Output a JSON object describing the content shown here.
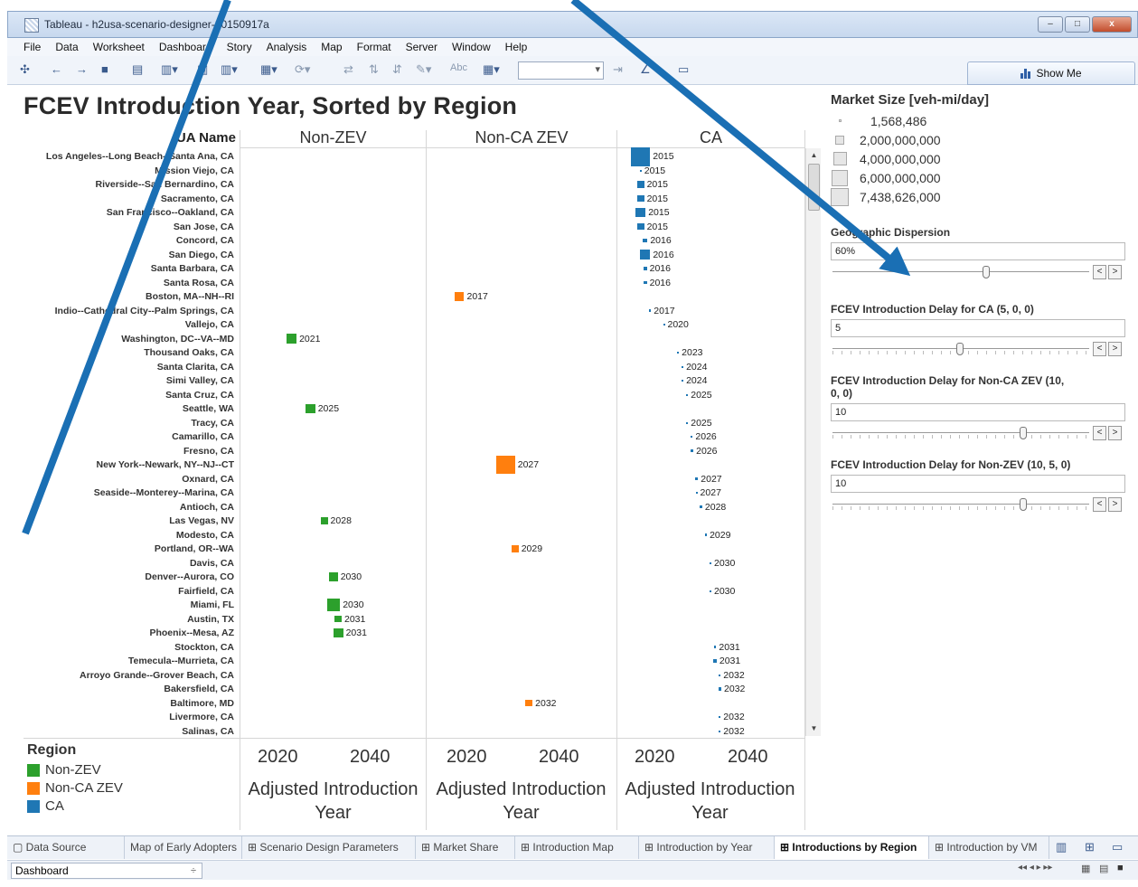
{
  "window": {
    "title": "Tableau - h2usa-scenario-designer-20150917a",
    "min": "–",
    "max": "□",
    "close": "x"
  },
  "menu": [
    "File",
    "Data",
    "Worksheet",
    "Dashboard",
    "Story",
    "Analysis",
    "Map",
    "Format",
    "Server",
    "Window",
    "Help"
  ],
  "toolbar": {
    "show_me": "Show Me",
    "abc": "Abc"
  },
  "viz": {
    "title": "FCEV Introduction Year, Sorted by Region",
    "row_header": "UA Name",
    "columns": [
      "Non-ZEV",
      "Non-CA ZEV",
      "CA"
    ],
    "x_ticks": [
      "2020",
      "2040"
    ],
    "x_title": "Adjusted Introduction Year"
  },
  "colors": {
    "Non-ZEV": "#2ca02c",
    "Non-CA ZEV": "#ff7f0e",
    "CA": "#1f77b4"
  },
  "chart_data": {
    "type": "scatter",
    "title": "FCEV Introduction Year, Sorted by Region",
    "xlabel": "Adjusted Introduction Year",
    "ylabel": "UA Name",
    "facets": [
      "Non-ZEV",
      "Non-CA ZEV",
      "CA"
    ],
    "xlim": [
      2010,
      2050
    ],
    "size_encoding": "Market Size [veh-mi/day]",
    "rows": [
      {
        "name": "Los Angeles--Long Beach--Santa Ana, CA",
        "region": "CA",
        "year": 2015,
        "size": 7438626000
      },
      {
        "name": "Mission Viejo, CA",
        "region": "CA",
        "year": 2015,
        "size": 1568486
      },
      {
        "name": "Riverside--San Bernardino, CA",
        "region": "CA",
        "year": 2015,
        "size": 1000000000
      },
      {
        "name": "Sacramento, CA",
        "region": "CA",
        "year": 2015,
        "size": 1000000000
      },
      {
        "name": "San Francisco--Oakland, CA",
        "region": "CA",
        "year": 2015,
        "size": 2000000000
      },
      {
        "name": "San Jose, CA",
        "region": "CA",
        "year": 2015,
        "size": 1000000000
      },
      {
        "name": "Concord, CA",
        "region": "CA",
        "year": 2016,
        "size": 400000000
      },
      {
        "name": "San Diego, CA",
        "region": "CA",
        "year": 2016,
        "size": 2000000000
      },
      {
        "name": "Santa Barbara, CA",
        "region": "CA",
        "year": 2016,
        "size": 200000000
      },
      {
        "name": "Santa Rosa, CA",
        "region": "CA",
        "year": 2016,
        "size": 200000000
      },
      {
        "name": "Boston, MA--NH--RI",
        "region": "Non-CA ZEV",
        "year": 2017,
        "size": 2000000000
      },
      {
        "name": "Indio--Cathedral City--Palm Springs, CA",
        "region": "CA",
        "year": 2017,
        "size": 100000000
      },
      {
        "name": "Vallejo, CA",
        "region": "CA",
        "year": 2020,
        "size": 50000000
      },
      {
        "name": "Washington, DC--VA--MD",
        "region": "Non-ZEV",
        "year": 2021,
        "size": 2000000000
      },
      {
        "name": "Thousand Oaks, CA",
        "region": "CA",
        "year": 2023,
        "size": 100000000
      },
      {
        "name": "Santa Clarita, CA",
        "region": "CA",
        "year": 2024,
        "size": 50000000
      },
      {
        "name": "Simi Valley, CA",
        "region": "CA",
        "year": 2024,
        "size": 50000000
      },
      {
        "name": "Santa Cruz, CA",
        "region": "CA",
        "year": 2025,
        "size": 50000000
      },
      {
        "name": "Seattle, WA",
        "region": "Non-ZEV",
        "year": 2025,
        "size": 2000000000
      },
      {
        "name": "Tracy, CA",
        "region": "CA",
        "year": 2025,
        "size": 50000000
      },
      {
        "name": "Camarillo, CA",
        "region": "CA",
        "year": 2026,
        "size": 50000000
      },
      {
        "name": "Fresno, CA",
        "region": "CA",
        "year": 2026,
        "size": 200000000
      },
      {
        "name": "New York--Newark, NY--NJ--CT",
        "region": "Non-CA ZEV",
        "year": 2027,
        "size": 7000000000
      },
      {
        "name": "Oxnard, CA",
        "region": "CA",
        "year": 2027,
        "size": 200000000
      },
      {
        "name": "Seaside--Monterey--Marina, CA",
        "region": "CA",
        "year": 2027,
        "size": 50000000
      },
      {
        "name": "Antioch, CA",
        "region": "CA",
        "year": 2028,
        "size": 100000000
      },
      {
        "name": "Las Vegas, NV",
        "region": "Non-ZEV",
        "year": 2028,
        "size": 1000000000
      },
      {
        "name": "Modesto, CA",
        "region": "CA",
        "year": 2029,
        "size": 100000000
      },
      {
        "name": "Portland, OR--WA",
        "region": "Non-CA ZEV",
        "year": 2029,
        "size": 1000000000
      },
      {
        "name": "Davis, CA",
        "region": "CA",
        "year": 2030,
        "size": 30000000
      },
      {
        "name": "Denver--Aurora, CO",
        "region": "Non-ZEV",
        "year": 2030,
        "size": 1500000000
      },
      {
        "name": "Fairfield, CA",
        "region": "CA",
        "year": 2030,
        "size": 30000000
      },
      {
        "name": "Miami, FL",
        "region": "Non-ZEV",
        "year": 2030,
        "size": 3500000000
      },
      {
        "name": "Austin, TX",
        "region": "Non-ZEV",
        "year": 2031,
        "size": 1000000000
      },
      {
        "name": "Phoenix--Mesa, AZ",
        "region": "Non-ZEV",
        "year": 2031,
        "size": 2000000000
      },
      {
        "name": "Stockton, CA",
        "region": "CA",
        "year": 2031,
        "size": 100000000
      },
      {
        "name": "Temecula--Murrieta, CA",
        "region": "CA",
        "year": 2031,
        "size": 200000000
      },
      {
        "name": "Arroyo Grande--Grover Beach, CA",
        "region": "CA",
        "year": 2032,
        "size": 30000000
      },
      {
        "name": "Bakersfield, CA",
        "region": "CA",
        "year": 2032,
        "size": 200000000
      },
      {
        "name": "Baltimore, MD",
        "region": "Non-CA ZEV",
        "year": 2032,
        "size": 1000000000
      },
      {
        "name": "Livermore, CA",
        "region": "CA",
        "year": 2032,
        "size": 30000000
      },
      {
        "name": "Salinas, CA",
        "region": "CA",
        "year": 2032,
        "size": 30000000
      }
    ]
  },
  "legend": {
    "title": "Region",
    "items": [
      {
        "label": "Non-ZEV",
        "color": "#2ca02c"
      },
      {
        "label": "Non-CA ZEV",
        "color": "#ff7f0e"
      },
      {
        "label": "CA",
        "color": "#1f77b4"
      }
    ]
  },
  "market_size": {
    "title": "Market Size [veh-mi/day]",
    "items": [
      "1,568,486",
      "2,000,000,000",
      "4,000,000,000",
      "6,000,000,000",
      "7,438,626,000"
    ]
  },
  "params": [
    {
      "title": "Geographic Dispersion",
      "value": "60%",
      "slider_fraction": 0.6
    },
    {
      "title": "FCEV Introduction Delay for CA  (5, 0, 0)",
      "value": "5",
      "slider_fraction": 0.5
    },
    {
      "title": "FCEV Introduction Delay for Non-CA ZEV (10, 0, 0)",
      "value": "10",
      "slider_fraction": 0.75
    },
    {
      "title": "FCEV Introduction Delay for Non-ZEV  (10, 5, 0)",
      "value": "10",
      "slider_fraction": 0.75
    }
  ],
  "tabs": [
    "Data Source",
    "Map of Early Adopters",
    "Scenario Design Parameters",
    "Market Share",
    "Introduction Map",
    "Introduction by Year",
    "Introductions by Region",
    "Introduction by VM"
  ],
  "active_tab": "Introductions by Region",
  "status": {
    "view": "Dashboard"
  }
}
